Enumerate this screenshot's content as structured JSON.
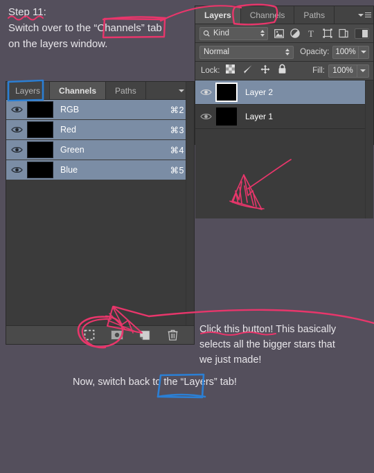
{
  "annotations": {
    "step_note": "Step 11:\nSwitch over to the “Channels” tab\non the layers window.",
    "click_note": "Click this button! This basically\nselects all the bigger stars that\nwe just made!",
    "switch_back_note": "Now, switch back to the “Layers” tab!",
    "marker_pink": "#e8366b",
    "marker_blue": "#2b7fd4"
  },
  "background_color": "#544f5c",
  "channels_panel": {
    "tabs": [
      {
        "label": "Layers",
        "active": false
      },
      {
        "label": "Channels",
        "active": true
      },
      {
        "label": "Paths",
        "active": false
      }
    ],
    "menu_icon": "panel-menu-icon",
    "rows": [
      {
        "name": "RGB",
        "shortcut": "⌘2",
        "visible": true,
        "selected": true
      },
      {
        "name": "Red",
        "shortcut": "⌘3",
        "visible": true,
        "selected": true
      },
      {
        "name": "Green",
        "shortcut": "⌘4",
        "visible": true,
        "selected": true
      },
      {
        "name": "Blue",
        "shortcut": "⌘5",
        "visible": true,
        "selected": true
      }
    ],
    "footer_buttons": [
      {
        "name": "load-channel-as-selection-icon",
        "title": "Load channel as selection"
      },
      {
        "name": "save-selection-as-channel-icon",
        "title": "Save selection as channel"
      },
      {
        "name": "create-new-channel-icon",
        "title": "Create new channel"
      },
      {
        "name": "delete-channel-icon",
        "title": "Delete current channel"
      }
    ]
  },
  "layers_panel": {
    "tabs": [
      {
        "label": "Layers",
        "active": true
      },
      {
        "label": "Channels",
        "active": false
      },
      {
        "label": "Paths",
        "active": false
      }
    ],
    "menu_icon": "panel-menu-icon",
    "filter": {
      "kind_label": "Kind",
      "kind_icon": "search-icon",
      "type_filters": [
        "pixel-layer-filter-icon",
        "adjustment-layer-filter-icon",
        "type-layer-filter-icon",
        "shape-layer-filter-icon",
        "smart-object-filter-icon"
      ],
      "toggle_name": "filter-enable-toggle"
    },
    "blend": {
      "mode": "Normal",
      "opacity_label": "Opacity:",
      "opacity_value": "100%"
    },
    "lock": {
      "label": "Lock:",
      "icons": [
        "lock-transparency-icon",
        "lock-image-pixels-icon",
        "lock-position-icon",
        "lock-all-icon"
      ],
      "fill_label": "Fill:",
      "fill_value": "100%"
    },
    "layers": [
      {
        "name": "Layer 2",
        "visible": true,
        "selected": true
      },
      {
        "name": "Layer 1",
        "visible": true,
        "selected": false
      }
    ]
  }
}
